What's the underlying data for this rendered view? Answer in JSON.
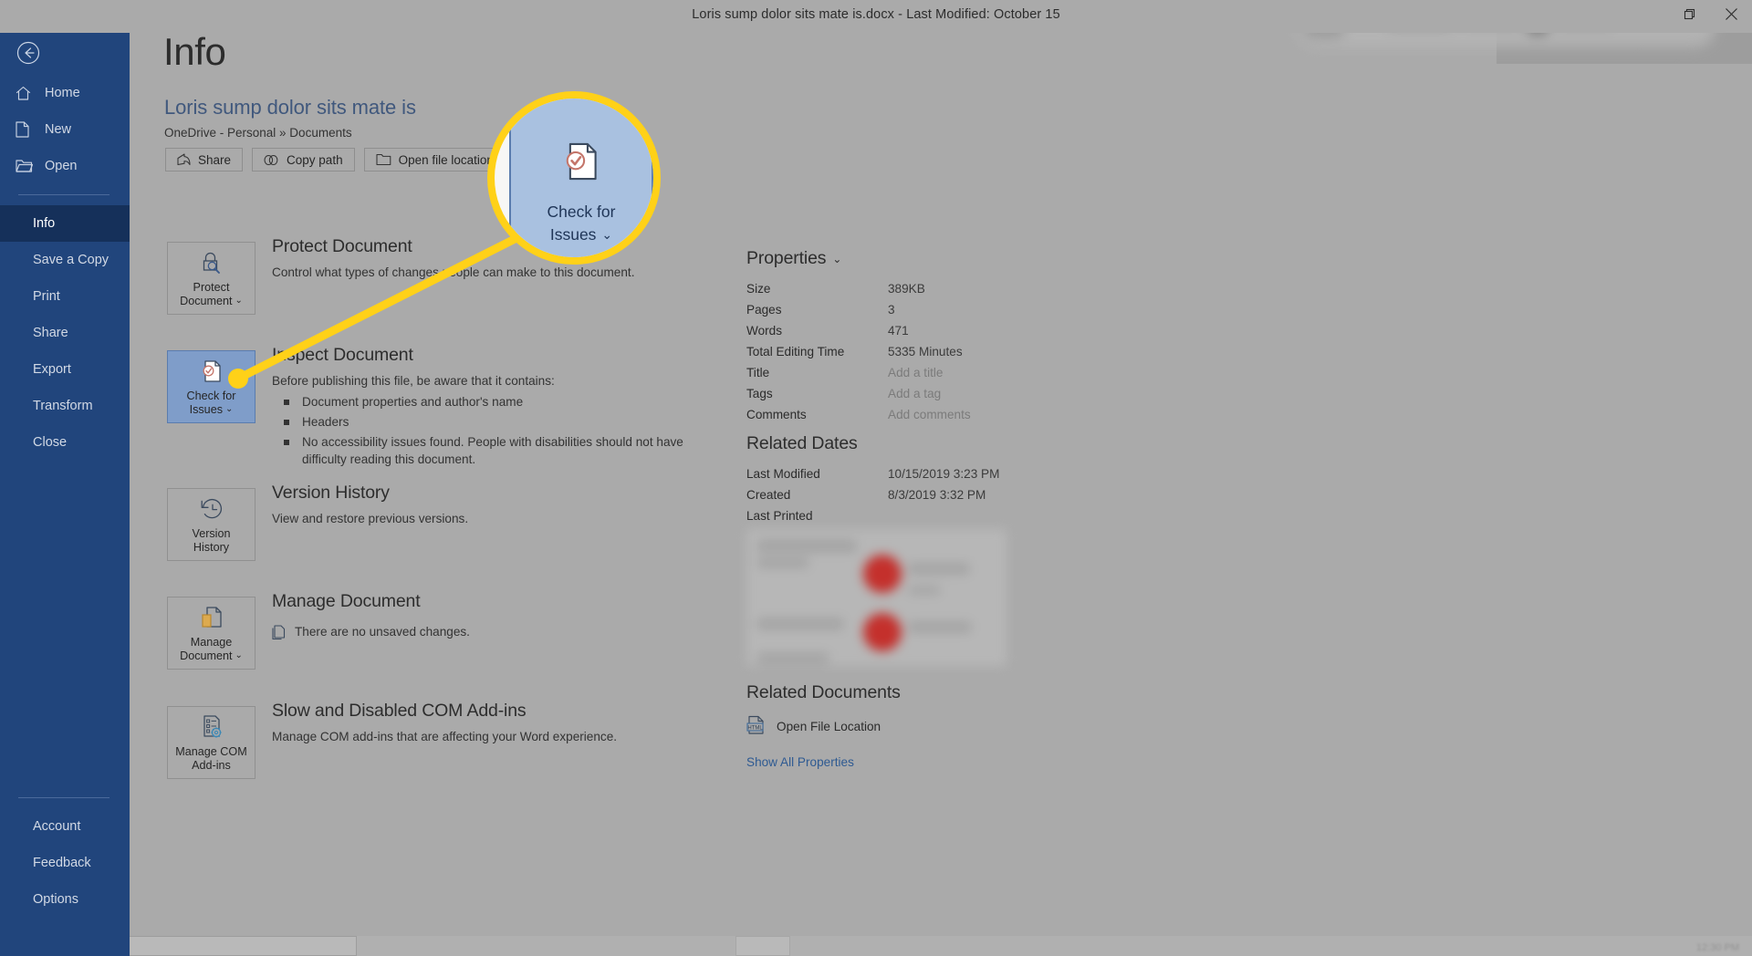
{
  "window": {
    "title": "Loris sump dolor sits mate is.docx  -  Last Modified: October 15",
    "restore_icon": "restore-icon",
    "close_icon": "close-icon"
  },
  "nav": {
    "back_icon": "back-arrow-icon",
    "top_items": [
      {
        "label": "Home",
        "icon": "home-icon"
      },
      {
        "label": "New",
        "icon": "new-document-icon"
      },
      {
        "label": "Open",
        "icon": "open-folder-icon"
      }
    ],
    "main_items": [
      {
        "label": "Info",
        "selected": true
      },
      {
        "label": "Save a Copy",
        "selected": false
      },
      {
        "label": "Print",
        "selected": false
      },
      {
        "label": "Share",
        "selected": false
      },
      {
        "label": "Export",
        "selected": false
      },
      {
        "label": "Transform",
        "selected": false
      },
      {
        "label": "Close",
        "selected": false
      }
    ],
    "bottom_items": [
      {
        "label": "Account"
      },
      {
        "label": "Feedback"
      },
      {
        "label": "Options"
      }
    ]
  },
  "page": {
    "title": "Info",
    "document_name": "Loris sump dolor sits mate is",
    "document_path": "OneDrive - Personal » Documents",
    "quick_actions": [
      {
        "label": "Share",
        "icon": "share-icon"
      },
      {
        "label": "Copy path",
        "icon": "link-icon"
      },
      {
        "label": "Open file location",
        "icon": "folder-open-icon"
      }
    ]
  },
  "sections": {
    "protect": {
      "button_line1": "Protect",
      "button_line2": "Document",
      "button_caret": "⌄",
      "icon": "lock-magnifier-icon",
      "heading": "Protect Document",
      "body": "Control what types of changes people can make to this document."
    },
    "inspect": {
      "button_line1": "Check for",
      "button_line2": "Issues",
      "button_caret": "⌄",
      "icon": "document-check-icon",
      "heading": "Inspect Document",
      "body": "Before publishing this file, be aware that it contains:",
      "bullets": [
        "Document properties and author's name",
        "Headers",
        "No accessibility issues found. People with disabilities should not have difficulty reading this document."
      ]
    },
    "version": {
      "button_line1": "Version",
      "button_line2": "History",
      "icon": "clock-back-icon",
      "heading": "Version History",
      "body": "View and restore previous versions."
    },
    "manage": {
      "button_line1": "Manage",
      "button_line2": "Document",
      "button_caret": "⌄",
      "icon": "manage-document-icon",
      "heading": "Manage Document",
      "note_icon": "unsaved-changes-icon",
      "note": "There are no unsaved changes."
    },
    "addins": {
      "button_line1": "Manage COM",
      "button_line2": "Add-ins",
      "icon": "com-addins-icon",
      "heading": "Slow and Disabled COM Add-ins",
      "body": "Manage COM add-ins that are affecting your Word experience."
    }
  },
  "properties": {
    "heading": "Properties",
    "caret": "⌄",
    "rows": [
      {
        "key": "Size",
        "value": "389KB",
        "placeholder": false
      },
      {
        "key": "Pages",
        "value": "3",
        "placeholder": false
      },
      {
        "key": "Words",
        "value": "471",
        "placeholder": false
      },
      {
        "key": "Total Editing Time",
        "value": "5335 Minutes",
        "placeholder": false
      },
      {
        "key": "Title",
        "value": "Add a title",
        "placeholder": true
      },
      {
        "key": "Tags",
        "value": "Add a tag",
        "placeholder": true
      },
      {
        "key": "Comments",
        "value": "Add comments",
        "placeholder": true
      }
    ]
  },
  "related_dates": {
    "heading": "Related Dates",
    "rows": [
      {
        "key": "Last Modified",
        "value": "10/15/2019 3:23 PM"
      },
      {
        "key": "Created",
        "value": "8/3/2019 3:32 PM"
      },
      {
        "key": "Last Printed",
        "value": ""
      }
    ]
  },
  "related_documents": {
    "heading": "Related Documents",
    "file_icon_label": "HTML",
    "open_location_label": "Open File Location",
    "show_all_label": "Show All Properties"
  },
  "callout": {
    "zoom_line1": "Check for",
    "zoom_line2": "Issues",
    "caret": "⌄",
    "highlight_color": "#ffd118",
    "icon": "document-check-icon"
  },
  "colors": {
    "nav_background": "#21457c",
    "nav_selected": "#15305a",
    "canvas": "#aaaaaa",
    "accent_blue": "#40587d",
    "active_tile": "#7f9dc9",
    "highlight_yellow": "#ffd118",
    "link": "#2e5a92"
  }
}
